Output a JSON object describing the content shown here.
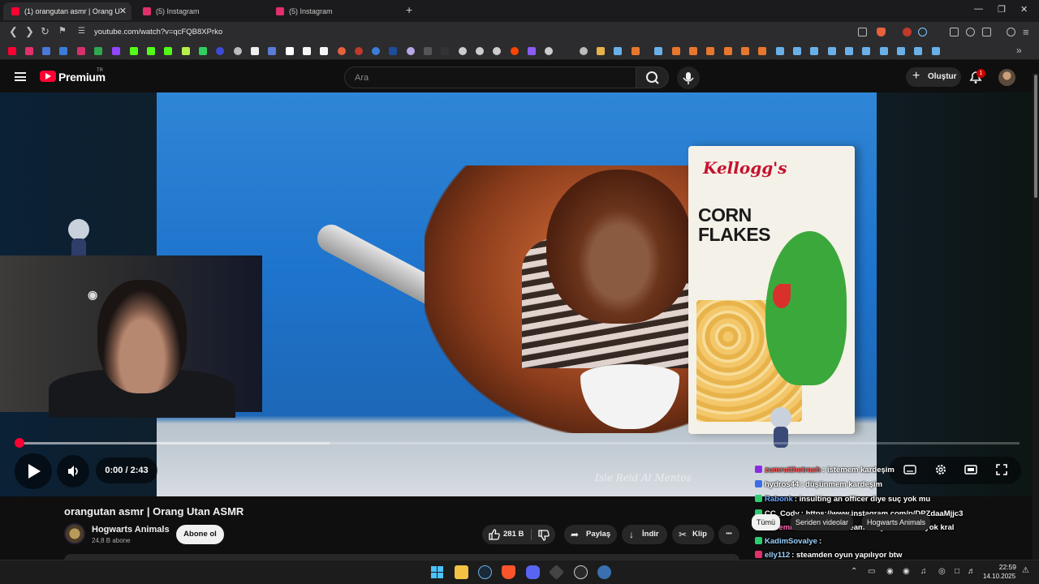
{
  "browser": {
    "tabs": [
      {
        "title": "(1) orangutan asmr | Orang Utan ASMR",
        "active": true,
        "favicon_color": "#ff0033"
      },
      {
        "title": "(5) Instagram",
        "active": false,
        "favicon_color": "#e1306c"
      },
      {
        "title": "(5) Instagram",
        "active": false,
        "favicon_color": "#e1306c"
      }
    ],
    "new_tab_label": "+",
    "url": "youtube.com/watch?v=qcFQB8XPrko",
    "window_controls": {
      "minimize": "—",
      "maximize": "❐",
      "close": "✕"
    }
  },
  "youtube": {
    "brand": "Premium",
    "country_code": "TR",
    "search_placeholder": "Ara",
    "create_label": "Oluştur",
    "notification_count": "1"
  },
  "video_frame": {
    "box_brand": "Kellogg's",
    "box_title_line1": "CORN",
    "box_title_line2": "FLAKES",
    "watermark": "Isle Reid Al Mentos"
  },
  "player": {
    "time": "0:00 / 2:43",
    "progress_fraction": 0.0,
    "buffered_fraction": 0.31
  },
  "chat": [
    {
      "user": "zumrutthetrash",
      "text": ": istemem kardeşim",
      "user_color": "#ff5a5a",
      "badge_color": "#8a2be2"
    },
    {
      "user": "hydros44",
      "text": ": düşünmem kardeşim",
      "user_color": "#ffffff",
      "badge_color": "#3b6ee8"
    },
    {
      "user": "Rabonk",
      "text": ": insulting an officer diye suç yok mu",
      "user_color": "#6aa8ff",
      "badge_color": "#2ecc71"
    },
    {
      "user": "CC_Cody",
      "text": ": https://www.instagram.com/p/DPZdaaMjjc3",
      "user_color": "#ffffff",
      "badge_color": "#2ecc71"
    },
    {
      "user": "bubemisinirlendirdi",
      "text": ": steam'in oyun motoru yok kral",
      "user_color": "#ff6ab5",
      "badge_color": "#e1306c"
    },
    {
      "user": "KadimSovalye",
      "text": ":",
      "user_color": "#9ad1ff",
      "badge_color": "#2ecc71"
    },
    {
      "user": "elly112",
      "text": ": steamden oyun yapılıyor btw",
      "user_color": "#9ad1ff",
      "badge_color": "#e1306c"
    }
  ],
  "video": {
    "title": "orangutan asmr | Orang Utan ASMR",
    "channel": "Hogwarts Animals",
    "subscribers": "24,8 B abone",
    "subscribe_label": "Abone ol",
    "likes": "281 B",
    "share_label": "Paylaş",
    "download_label": "İndir",
    "clip_label": "Klip",
    "more_label": "•••"
  },
  "filter_chips": [
    "Tümü",
    "Seriden videolar",
    "Hogwarts Animals"
  ],
  "taskbar": {
    "time": "22:59",
    "date": "14.10.2025"
  }
}
